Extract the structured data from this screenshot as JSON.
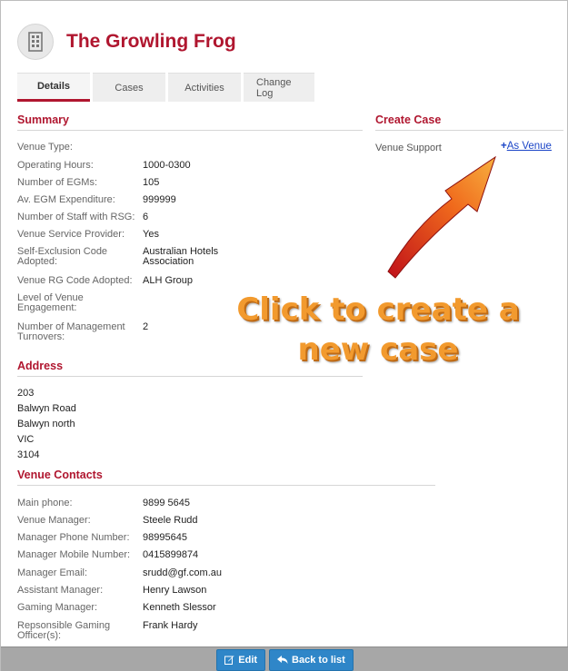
{
  "venue": {
    "title": "The Growling Frog",
    "icon": "building-icon"
  },
  "tabs": [
    {
      "label": "Details",
      "active": true
    },
    {
      "label": "Cases",
      "active": false
    },
    {
      "label": "Activities",
      "active": false
    },
    {
      "label": "Change Log",
      "active": false
    }
  ],
  "summary": {
    "title": "Summary",
    "rows": [
      {
        "label": "Venue Type:",
        "value": ""
      },
      {
        "label": "Operating Hours:",
        "value": "1000-0300"
      },
      {
        "label": "Number of EGMs:",
        "value": "105"
      },
      {
        "label": "Av. EGM Expenditure:",
        "value": "999999"
      },
      {
        "label": "Number of Staff with RSG:",
        "value": "6"
      },
      {
        "label": "Venue Service Provider:",
        "value": "Yes"
      },
      {
        "label": "Self-Exclusion Code Adopted:",
        "value": "Australian Hotels Association"
      },
      {
        "label": "Venue RG Code Adopted:",
        "value": "ALH Group"
      },
      {
        "label": "Level of Venue Engagement:",
        "value": ""
      },
      {
        "label": "Number of Management Turnovers:",
        "value": "2"
      }
    ]
  },
  "address": {
    "title": "Address",
    "lines": [
      "203",
      "Balwyn Road",
      "Balwyn north",
      "VIC",
      "3104"
    ]
  },
  "contacts": {
    "title": "Venue Contacts",
    "rows": [
      {
        "label": "Main phone:",
        "value": "9899 5645"
      },
      {
        "label": "Venue Manager:",
        "value": "Steele Rudd"
      },
      {
        "label": "Manager Phone Number:",
        "value": "98995645"
      },
      {
        "label": "Manager Mobile Number:",
        "value": "0415899874"
      },
      {
        "label": "Manager Email:",
        "value": "srudd@gf.com.au"
      },
      {
        "label": "Assistant Manager:",
        "value": "Henry Lawson"
      },
      {
        "label": "Gaming Manager:",
        "value": "Kenneth Slessor"
      },
      {
        "label": "Repsonsible Gaming Officer(s):",
        "value": "Frank Hardy"
      }
    ]
  },
  "create_case": {
    "title": "Create Case",
    "label": "Venue Support",
    "link_plus": "+",
    "link_text": "As Venue"
  },
  "annotation": {
    "line1": "Click to create a",
    "line2": "new case"
  },
  "footer": {
    "edit_label": "Edit",
    "back_label": "Back to list"
  },
  "colors": {
    "accent": "#b0162f",
    "button": "#2f86c8",
    "link": "#1b45c7",
    "callout": "#f29a2e"
  }
}
